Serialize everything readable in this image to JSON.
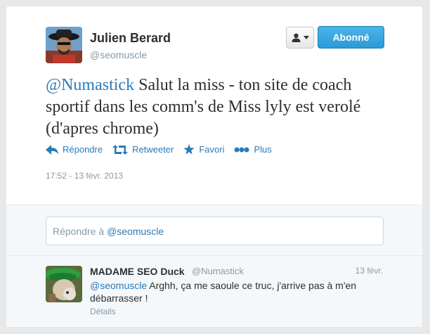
{
  "main_tweet": {
    "fullname": "Julien Berard",
    "username": "@seomuscle",
    "follow_button": "Abonné",
    "text_mention": "@Numastick",
    "text_body": " Salut la miss - ton site de coach sportif dans les comm's de Miss lyly est verolé (d'apres chrome)",
    "actions": {
      "reply": "Répondre",
      "retweet": "Retweeter",
      "favorite": "Favori",
      "more": "Plus"
    },
    "timestamp": "17:52 - 13 févr. 2013"
  },
  "reply_box": {
    "prefix": "Répondre à ",
    "mention": "@seomuscle"
  },
  "reply_tweet": {
    "fullname": "MADAME SEO Duck",
    "username": "@Numastick",
    "time": "13 févr.",
    "text_mention": "@seomuscle",
    "text_body": " Arghh, ça me saoule ce truc, j'arrive pas à m'en débarrasser !",
    "details": "Détails"
  },
  "icons": {
    "reply": "reply-arrow-icon",
    "retweet": "retweet-icon",
    "favorite": "star-icon",
    "more": "dots-icon",
    "user": "user-icon"
  },
  "colors": {
    "link": "#2b7bb9",
    "follow_button": "#2a9ad8",
    "muted": "#8899a6"
  }
}
